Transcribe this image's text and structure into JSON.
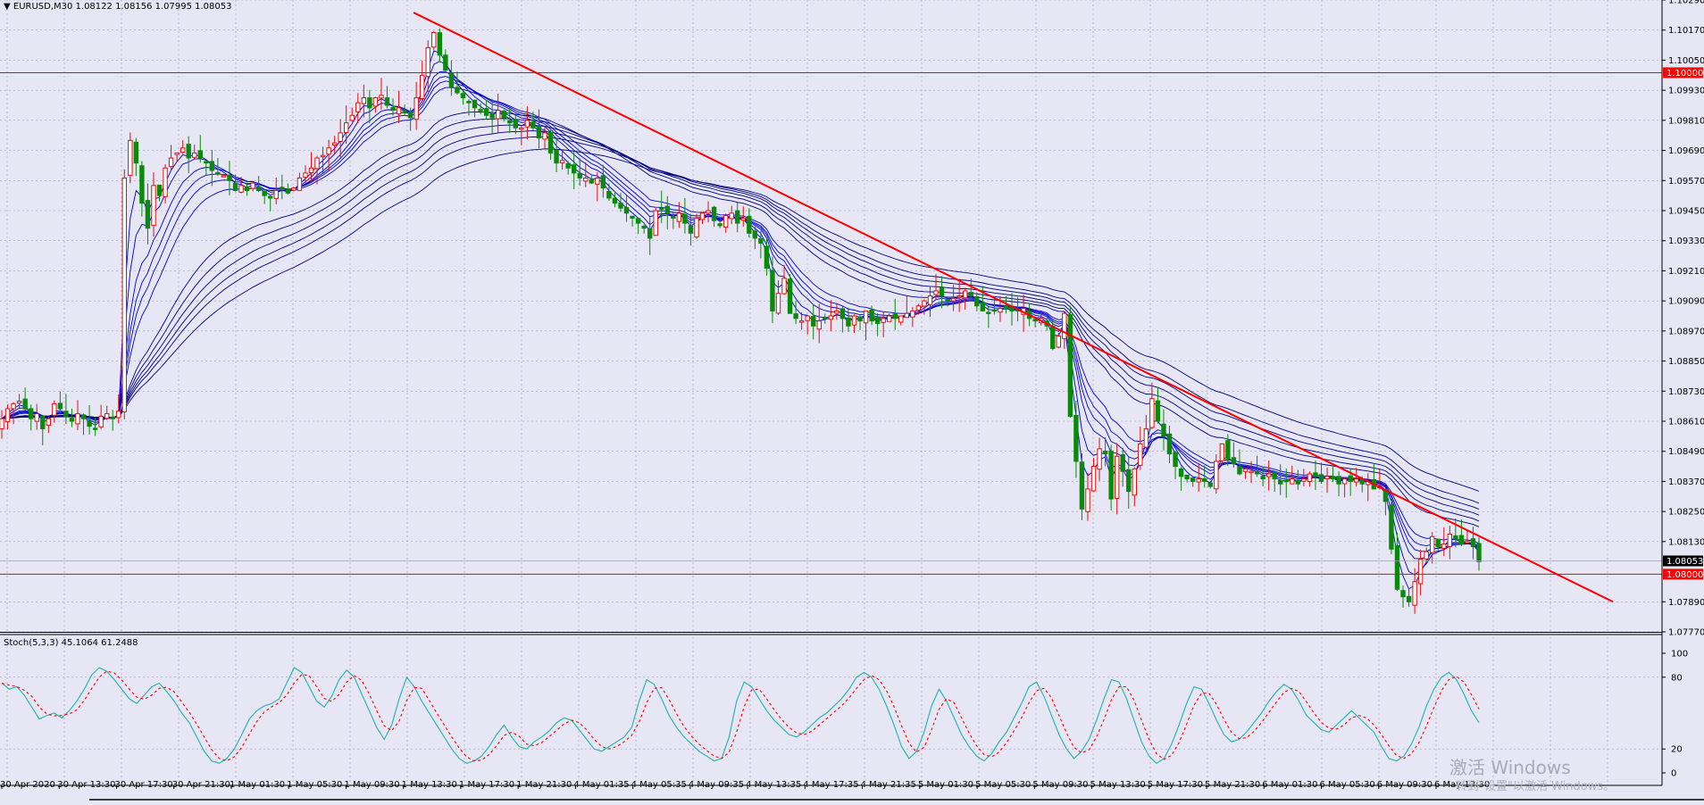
{
  "header": {
    "symbol_line": "▼ EURUSD,M30  1.08122 1.08156 1.07995 1.08053"
  },
  "stoch": {
    "label": "Stoch(5,3,3) 45.1064 61.2488"
  },
  "watermark": {
    "line1": "激活 Windows",
    "line2": "转到\"设置\"以激活 Windows。"
  },
  "colors": {
    "background": "#e6e6f5",
    "grid": "#9aa0b8",
    "bull_candle": "#e01010",
    "bear_candle": "#0a8a0a",
    "trendline": "#ff0000",
    "level_line": "#ff0000",
    "ma_ribbon": "#00007a",
    "stoch_main": "#20b2aa",
    "stoch_signal": "#ff0000"
  },
  "chart_data": [
    {
      "type": "candlestick",
      "title": "EURUSD,M30",
      "ylim": [
        1.0777,
        1.1029
      ],
      "y_ticks": [
        "1.10290",
        "1.10170",
        "1.10050",
        "1.09930",
        "1.09810",
        "1.09690",
        "1.09570",
        "1.09450",
        "1.09330",
        "1.09210",
        "1.09090",
        "1.08970",
        "1.08850",
        "1.08730",
        "1.08610",
        "1.08490",
        "1.08370",
        "1.08250",
        "1.08130",
        "1.07890",
        "1.07770"
      ],
      "x_labels": [
        "30 Apr 2020",
        "30 Apr 13:30",
        "30 Apr 17:30",
        "30 Apr 21:30",
        "1 May 01:30",
        "1 May 05:30",
        "1 May 09:30",
        "1 May 13:30",
        "1 May 17:30",
        "1 May 21:30",
        "4 May 01:35",
        "4 May 05:35",
        "4 May 09:35",
        "4 May 13:35",
        "4 May 17:35",
        "4 May 21:35",
        "5 May 01:30",
        "5 May 05:30",
        "5 May 09:30",
        "5 May 13:30",
        "5 May 17:30",
        "5 May 21:30",
        "6 May 01:30",
        "6 May 05:30",
        "6 May 09:30",
        "6 May 13:30"
      ],
      "horizontal_levels": [
        {
          "value": 1.1,
          "label": "1.10000"
        },
        {
          "value": 1.08,
          "label": "1.08000"
        }
      ],
      "current_price": {
        "value": 1.08053,
        "label": "1.08053"
      },
      "last_bar": {
        "open": 1.08122,
        "high": 1.08156,
        "low": 1.07995,
        "close": 1.08053
      },
      "trendline": {
        "start": {
          "x": "1 May 11:00",
          "y": 1.1024
        },
        "end": {
          "x": "6 May 19:00",
          "y": 1.0789
        }
      },
      "close_path": [
        1.0862,
        1.0866,
        1.0868,
        1.0869,
        1.0866,
        1.0862,
        1.0864,
        1.0858,
        1.0862,
        1.0868,
        1.0866,
        1.0863,
        1.0861,
        1.0864,
        1.0862,
        1.0859,
        1.0858,
        1.0863,
        1.0864,
        1.0862,
        1.0865,
        1.0958,
        1.0973,
        1.0964,
        1.0948,
        1.0938,
        1.0955,
        1.0951,
        1.0962,
        1.0966,
        1.0968,
        1.097,
        1.0966,
        1.0968,
        1.0966,
        1.0964,
        1.0961,
        1.096,
        1.0959,
        1.0957,
        1.0953,
        1.0955,
        1.0953,
        1.0956,
        1.0953,
        1.0951,
        1.095,
        1.0953,
        1.0954,
        1.0952,
        1.0954,
        1.0958,
        1.096,
        1.0962,
        1.0966,
        1.0967,
        1.097,
        1.0972,
        1.0976,
        1.098,
        1.0983,
        1.0988,
        1.099,
        1.0986,
        1.099,
        1.0991,
        1.0987,
        1.0985,
        1.0986,
        1.0984,
        1.0982,
        1.099,
        1.0999,
        1.101,
        1.1016,
        1.1007,
        1.1001,
        1.0994,
        1.0992,
        1.099,
        1.0988,
        1.0986,
        1.0985,
        1.0983,
        1.0982,
        1.0985,
        1.0982,
        1.098,
        1.0978,
        1.0978,
        1.0981,
        1.0978,
        1.0974,
        1.0976,
        1.0968,
        1.0964,
        1.0965,
        1.0962,
        1.096,
        1.0958,
        1.0958,
        1.0956,
        1.0958,
        1.0954,
        1.095,
        1.0948,
        1.0946,
        1.0944,
        1.0942,
        1.094,
        1.0938,
        1.0934,
        1.0945,
        1.0946,
        1.0944,
        1.0942,
        1.0944,
        1.094,
        1.0936,
        1.0942,
        1.0944,
        1.0945,
        1.0941,
        1.0939,
        1.0943,
        1.0944,
        1.094,
        1.0942,
        1.0936,
        1.0934,
        1.0932,
        1.0922,
        1.0905,
        1.0912,
        1.0918,
        1.0904,
        1.0902,
        1.0901,
        1.0903,
        1.0899,
        1.0901,
        1.0902,
        1.0903,
        1.0905,
        1.0902,
        1.0899,
        1.0903,
        1.0901,
        1.0905,
        1.0901,
        1.09,
        1.0902,
        1.0903,
        1.0902,
        1.0903,
        1.0904,
        1.0905,
        1.0907,
        1.0909,
        1.0911,
        1.0913,
        1.0911,
        1.0909,
        1.091,
        1.0911,
        1.0913,
        1.0911,
        1.0907,
        1.0905,
        1.0904,
        1.0905,
        1.0906,
        1.0906,
        1.0905,
        1.0905,
        1.0906,
        1.0902,
        1.0901,
        1.0902,
        1.0899,
        1.089,
        1.0895,
        1.0904,
        1.0863,
        1.0845,
        1.0826,
        1.0834,
        1.0843,
        1.085,
        1.0848,
        1.083,
        1.0847,
        1.0841,
        1.0833,
        1.0842,
        1.0852,
        1.0858,
        1.087,
        1.0861,
        1.0855,
        1.0848,
        1.0843,
        1.0839,
        1.0838,
        1.0837,
        1.0838,
        1.0837,
        1.0835,
        1.0845,
        1.0852,
        1.0846,
        1.0844,
        1.084,
        1.0842,
        1.0841,
        1.084,
        1.0838,
        1.084,
        1.0838,
        1.0836,
        1.0837,
        1.0838,
        1.0836,
        1.0838,
        1.084,
        1.0839,
        1.0837,
        1.0839,
        1.0838,
        1.0836,
        1.0838,
        1.0837,
        1.0838,
        1.0836,
        1.0837,
        1.0834,
        1.0835,
        1.0829,
        1.081,
        1.0794,
        1.0791,
        1.0789,
        1.0797,
        1.0806,
        1.0809,
        1.0815,
        1.0811,
        1.0812,
        1.0816,
        1.0814,
        1.0812,
        1.0813,
        1.0811,
        1.0805
      ]
    },
    {
      "type": "line",
      "title": "Stoch(5,3,3) 45.1064 61.2488",
      "ylim": [
        0,
        100
      ],
      "y_ticks": [
        "100",
        "80",
        "20",
        "0"
      ],
      "levels": [
        80,
        20
      ],
      "main_last": 45.1064,
      "signal_last": 61.2488,
      "main": [
        75,
        70,
        72,
        65,
        55,
        45,
        48,
        50,
        46,
        52,
        60,
        70,
        82,
        88,
        85,
        78,
        70,
        62,
        58,
        65,
        72,
        75,
        68,
        60,
        50,
        42,
        30,
        18,
        10,
        8,
        12,
        20,
        32,
        45,
        52,
        56,
        58,
        62,
        75,
        88,
        84,
        72,
        60,
        55,
        64,
        78,
        86,
        80,
        66,
        52,
        38,
        28,
        40,
        62,
        80,
        72,
        60,
        50,
        40,
        30,
        20,
        12,
        8,
        10,
        14,
        22,
        32,
        40,
        30,
        22,
        20,
        26,
        30,
        35,
        42,
        46,
        44,
        36,
        28,
        20,
        18,
        22,
        26,
        30,
        38,
        60,
        78,
        74,
        62,
        48,
        38,
        30,
        24,
        18,
        14,
        10,
        12,
        30,
        60,
        76,
        72,
        62,
        52,
        44,
        38,
        32,
        30,
        34,
        40,
        46,
        50,
        56,
        62,
        70,
        80,
        84,
        80,
        70,
        56,
        40,
        22,
        12,
        18,
        34,
        56,
        70,
        60,
        46,
        32,
        22,
        14,
        10,
        16,
        26,
        34,
        46,
        58,
        72,
        76,
        64,
        48,
        32,
        20,
        12,
        18,
        28,
        44,
        62,
        78,
        76,
        62,
        44,
        26,
        14,
        8,
        12,
        24,
        40,
        58,
        72,
        70,
        58,
        44,
        32,
        26,
        28,
        34,
        42,
        50,
        60,
        68,
        74,
        70,
        60,
        48,
        42,
        36,
        34,
        40,
        46,
        52,
        46,
        40,
        34,
        22,
        12,
        10,
        14,
        24,
        38,
        56,
        70,
        80,
        84,
        78,
        66,
        52,
        42
      ]
    }
  ]
}
